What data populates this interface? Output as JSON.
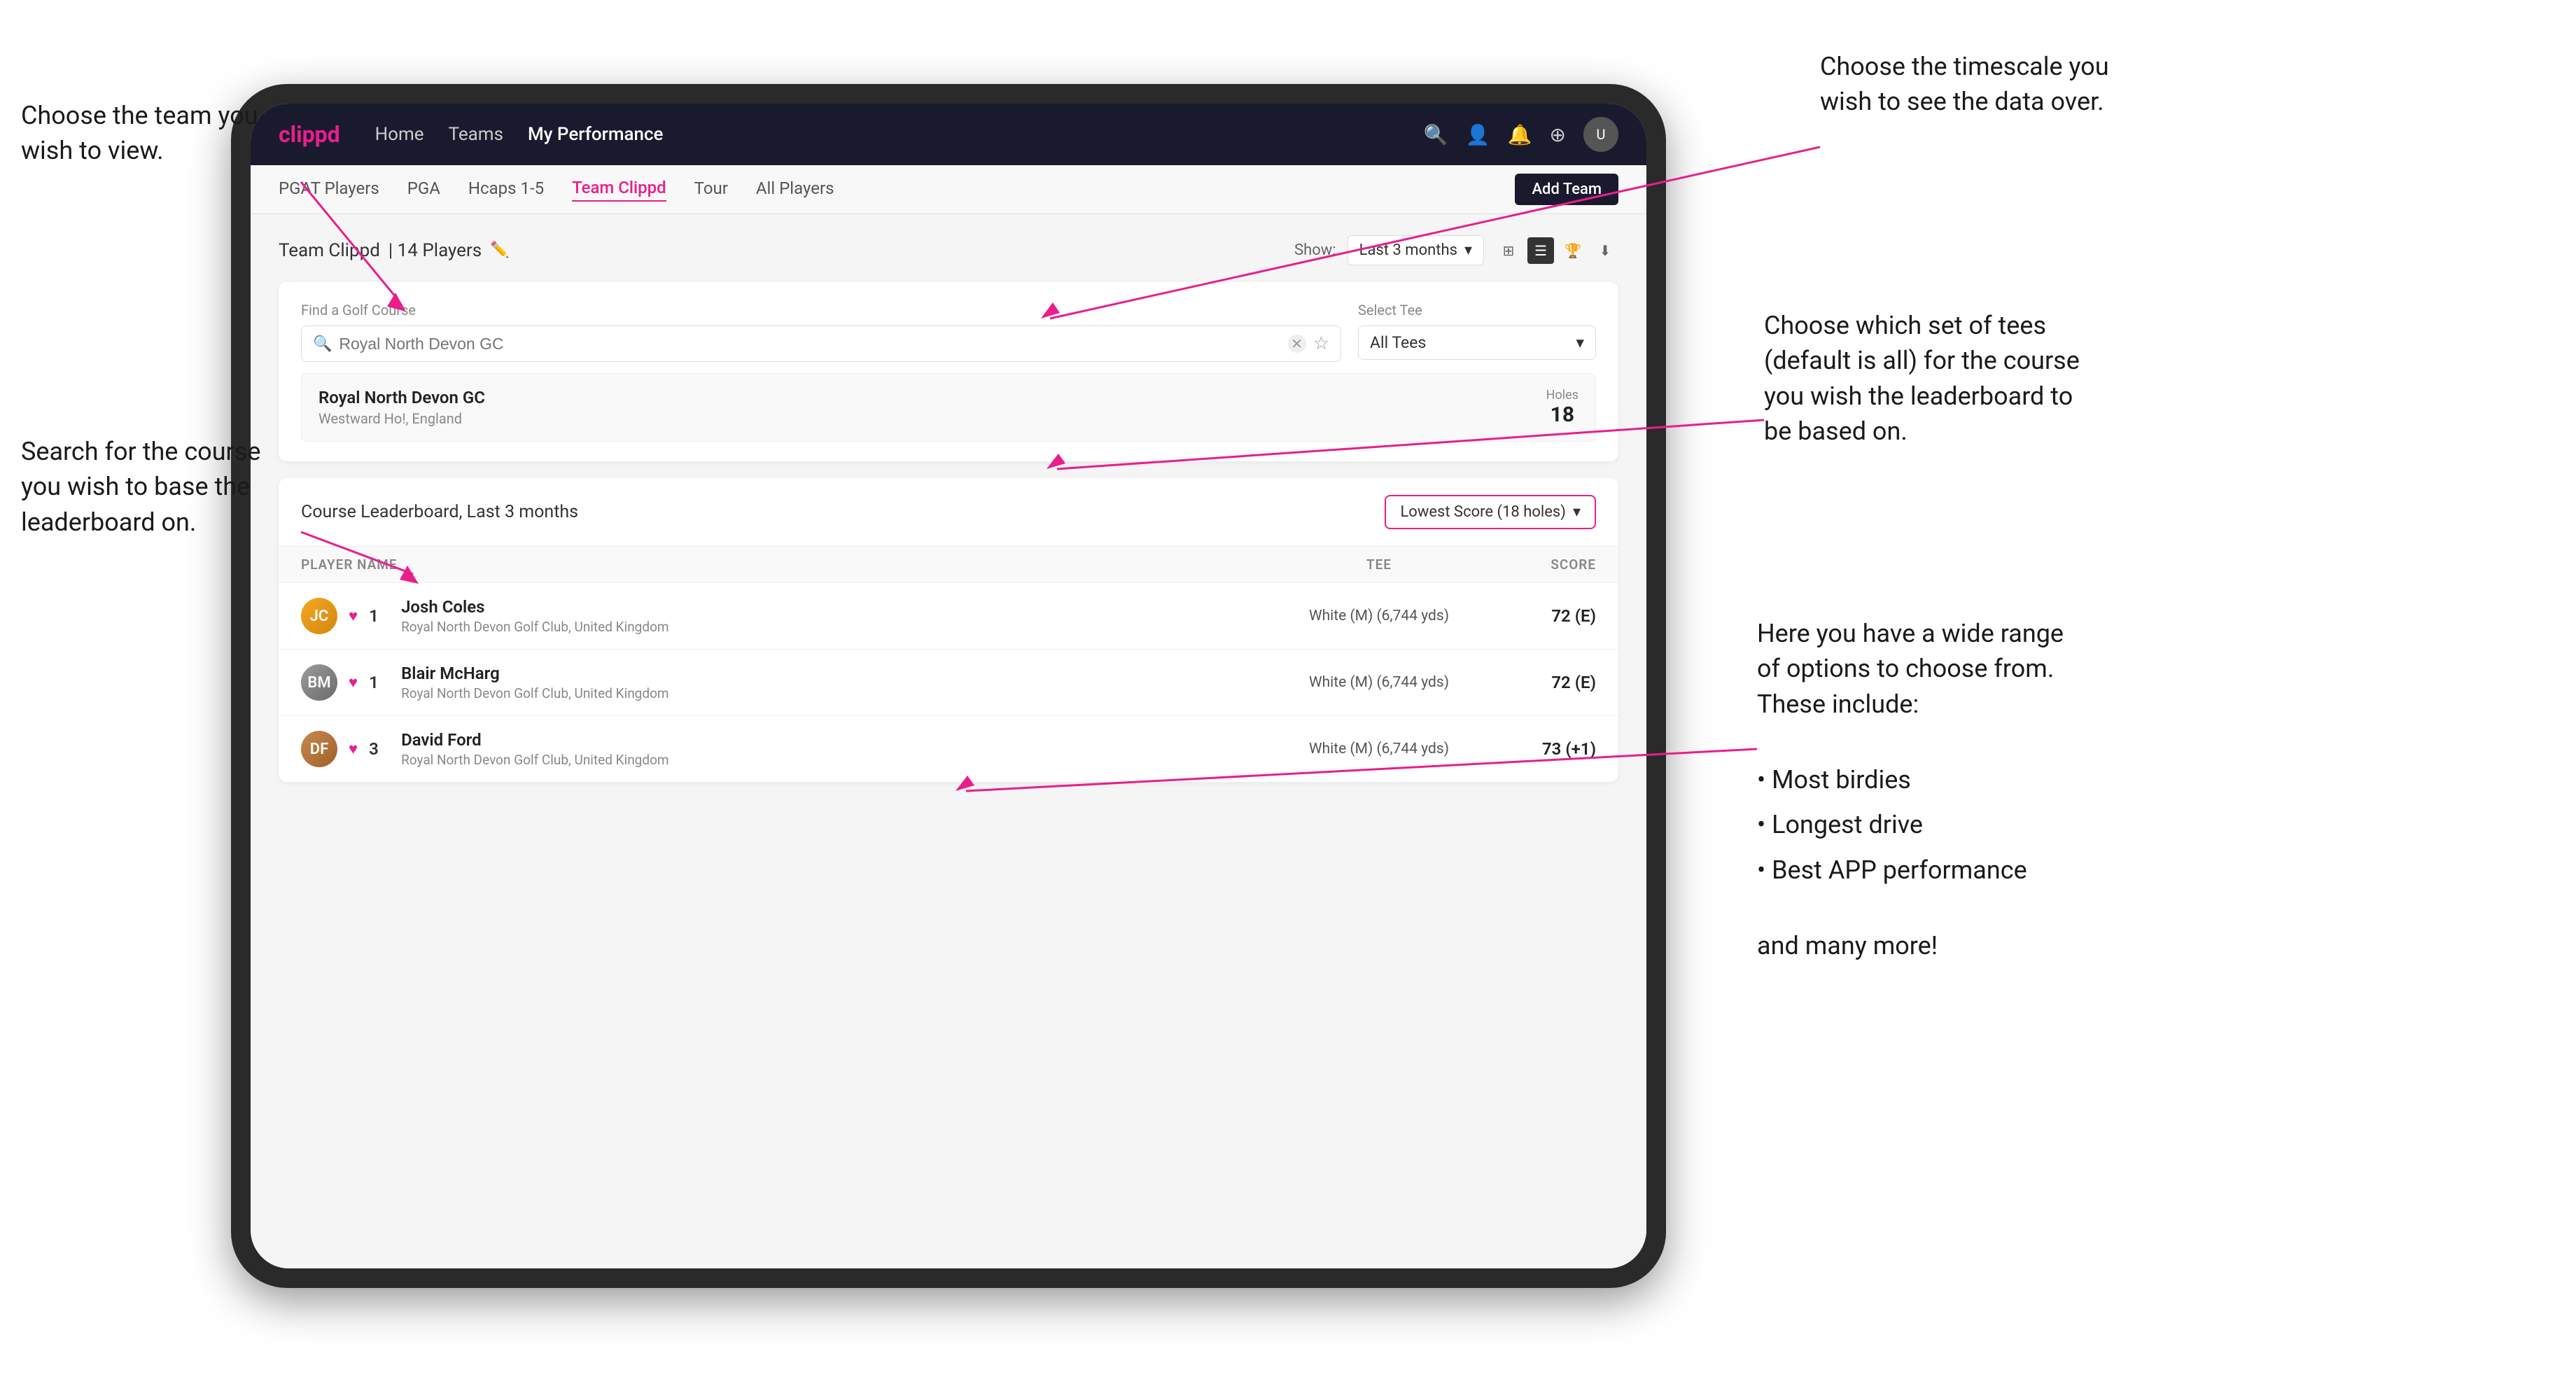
{
  "annotations": {
    "top_left_title": "Choose the team you\nwish to view.",
    "middle_left_title": "Search for the course\nyou wish to base the\nleaderboard on.",
    "top_right_title": "Choose the timescale you\nwish to see the data over.",
    "middle_right_title": "Choose which set of tees\n(default is all) for the course\nyou wish the leaderboard to\nbe based on.",
    "bottom_right_title": "Here you have a wide range\nof options to choose from.\nThese include:",
    "bullet_items": [
      "Most birdies",
      "Longest drive",
      "Best APP performance"
    ],
    "and_more": "and many more!"
  },
  "nav": {
    "logo": "clippd",
    "links": [
      "Home",
      "Teams",
      "My Performance"
    ],
    "active_link": "My Performance"
  },
  "sub_nav": {
    "links": [
      "PGAT Players",
      "PGA",
      "Hcaps 1-5",
      "Team Clippd",
      "Tour",
      "All Players"
    ],
    "active_link": "Team Clippd",
    "add_team_label": "Add Team"
  },
  "team_header": {
    "title": "Team Clippd",
    "player_count": "14 Players",
    "show_label": "Show:",
    "time_period": "Last 3 months"
  },
  "search": {
    "find_label": "Find a Golf Course",
    "placeholder": "Royal North Devon GC",
    "select_tee_label": "Select Tee",
    "tee_value": "All Tees"
  },
  "course_result": {
    "name": "Royal North Devon GC",
    "location": "Westward Ho!, England",
    "holes_label": "Holes",
    "holes_value": "18"
  },
  "leaderboard": {
    "title": "Course Leaderboard, Last 3 months",
    "score_dropdown": "Lowest Score (18 holes)",
    "columns": {
      "player": "PLAYER NAME",
      "tee": "TEE",
      "score": "SCORE"
    },
    "players": [
      {
        "rank": "1",
        "name": "Josh Coles",
        "club": "Royal North Devon Golf Club, United Kingdom",
        "tee": "White (M) (6,744 yds)",
        "score": "72 (E)",
        "avatar_color": "gold"
      },
      {
        "rank": "1",
        "name": "Blair McHarg",
        "club": "Royal North Devon Golf Club, United Kingdom",
        "tee": "White (M) (6,744 yds)",
        "score": "72 (E)",
        "avatar_color": "silver"
      },
      {
        "rank": "3",
        "name": "David Ford",
        "club": "Royal North Devon Golf Club, United Kingdom",
        "tee": "White (M) (6,744 yds)",
        "score": "73 (+1)",
        "avatar_color": "bronze"
      }
    ]
  }
}
